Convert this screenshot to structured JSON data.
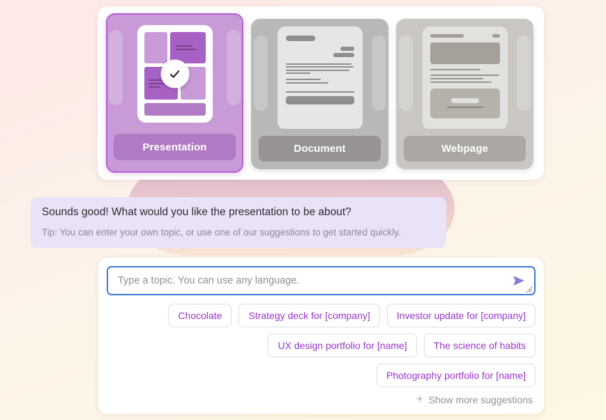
{
  "background": {
    "gradient_from": "#fdeae6",
    "gradient_to": "#fef7e3",
    "blob_color": "#c48eb4"
  },
  "chooser": {
    "cards": [
      {
        "label": "Presentation",
        "selected": true,
        "selected_icon": "check-icon",
        "accent": "#b45fd6",
        "fill": "#c89ad8",
        "label_fill": "#b07ac4"
      },
      {
        "label": "Document",
        "selected": false,
        "accent": "#b8b8b8",
        "fill": "#b8b8b8",
        "label_fill": "#979393"
      },
      {
        "label": "Webpage",
        "selected": false,
        "accent": "#cac7c3",
        "fill": "#cac7c3",
        "label_fill": "#aba8a3"
      }
    ]
  },
  "assistant_message": {
    "title": "Sounds good! What would you like the presentation to be about?",
    "tip": "Tip: You can enter your own topic, or use one of our suggestions to get started quickly.",
    "bubble_color": "#eae2f7"
  },
  "composer": {
    "input": {
      "value": "",
      "placeholder": "Type a topic. You can use any language.",
      "focus_border_color": "#3b78d8"
    },
    "send_icon": "send-arrow-icon",
    "send_icon_color": "#8c7ae0",
    "resize_icon": "resize-grip-icon",
    "suggestions": [
      "Chocolate",
      "Strategy deck for [company]",
      "Investor update for [company]",
      "UX design portfolio for [name]",
      "The science of habits",
      "Photography portfolio for [name]"
    ],
    "suggestion_color": "#9933cc",
    "show_more": {
      "icon": "plus-icon",
      "label": "Show more suggestions"
    }
  }
}
